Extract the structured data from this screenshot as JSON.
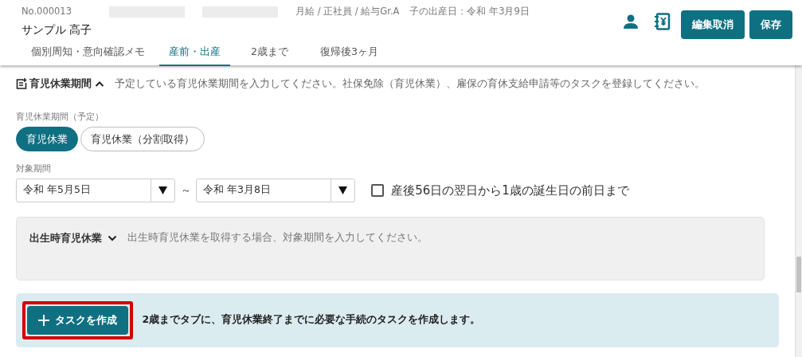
{
  "header": {
    "employee_no": "No.000013",
    "employee_name": "サンプル 高子",
    "employment": "月給 / 正社員 / 給与Gr.A",
    "birth_date": "子の出産日：令和  年3月9日",
    "buttons": [
      {
        "label": "編集取消"
      },
      {
        "label": "保存"
      }
    ]
  },
  "tabs": [
    {
      "label": "個別周知・意向確認メモ",
      "selected": false
    },
    {
      "label": "産前・出産",
      "selected": true
    },
    {
      "label": "2歳まで",
      "selected": false
    },
    {
      "label": "復帰後3ヶ月",
      "selected": false
    }
  ],
  "leave_section": {
    "title": "育児休業期間",
    "expanded": true,
    "description": "予定している育児休業期間を入力してください。社保免除（育児休業）、雇保の育休支給申請等のタスクを登録してください。",
    "type_label": "育児休業期間（予定）",
    "types": [
      {
        "label": "育児休業",
        "selected": true
      },
      {
        "label": "育児休業（分割取得）",
        "selected": false
      }
    ],
    "period_label": "対象期間",
    "period_start": "令和  年5月5日",
    "separator": "～",
    "period_end": "令和  年3月8日",
    "auto_period": {
      "label": "産後56日の翌日から1歳の誕生日の前日まで",
      "checked": false
    }
  },
  "birth_leave_section": {
    "title": "出生時育児休業",
    "expanded": false,
    "description": "出生時育児休業を取得する場合、対象期間を入力してください。"
  },
  "task_panel": {
    "button": "タスクを作成",
    "message": "2歳までタブに、育児休業終了までに必要な手続のタスクを作成します。"
  }
}
